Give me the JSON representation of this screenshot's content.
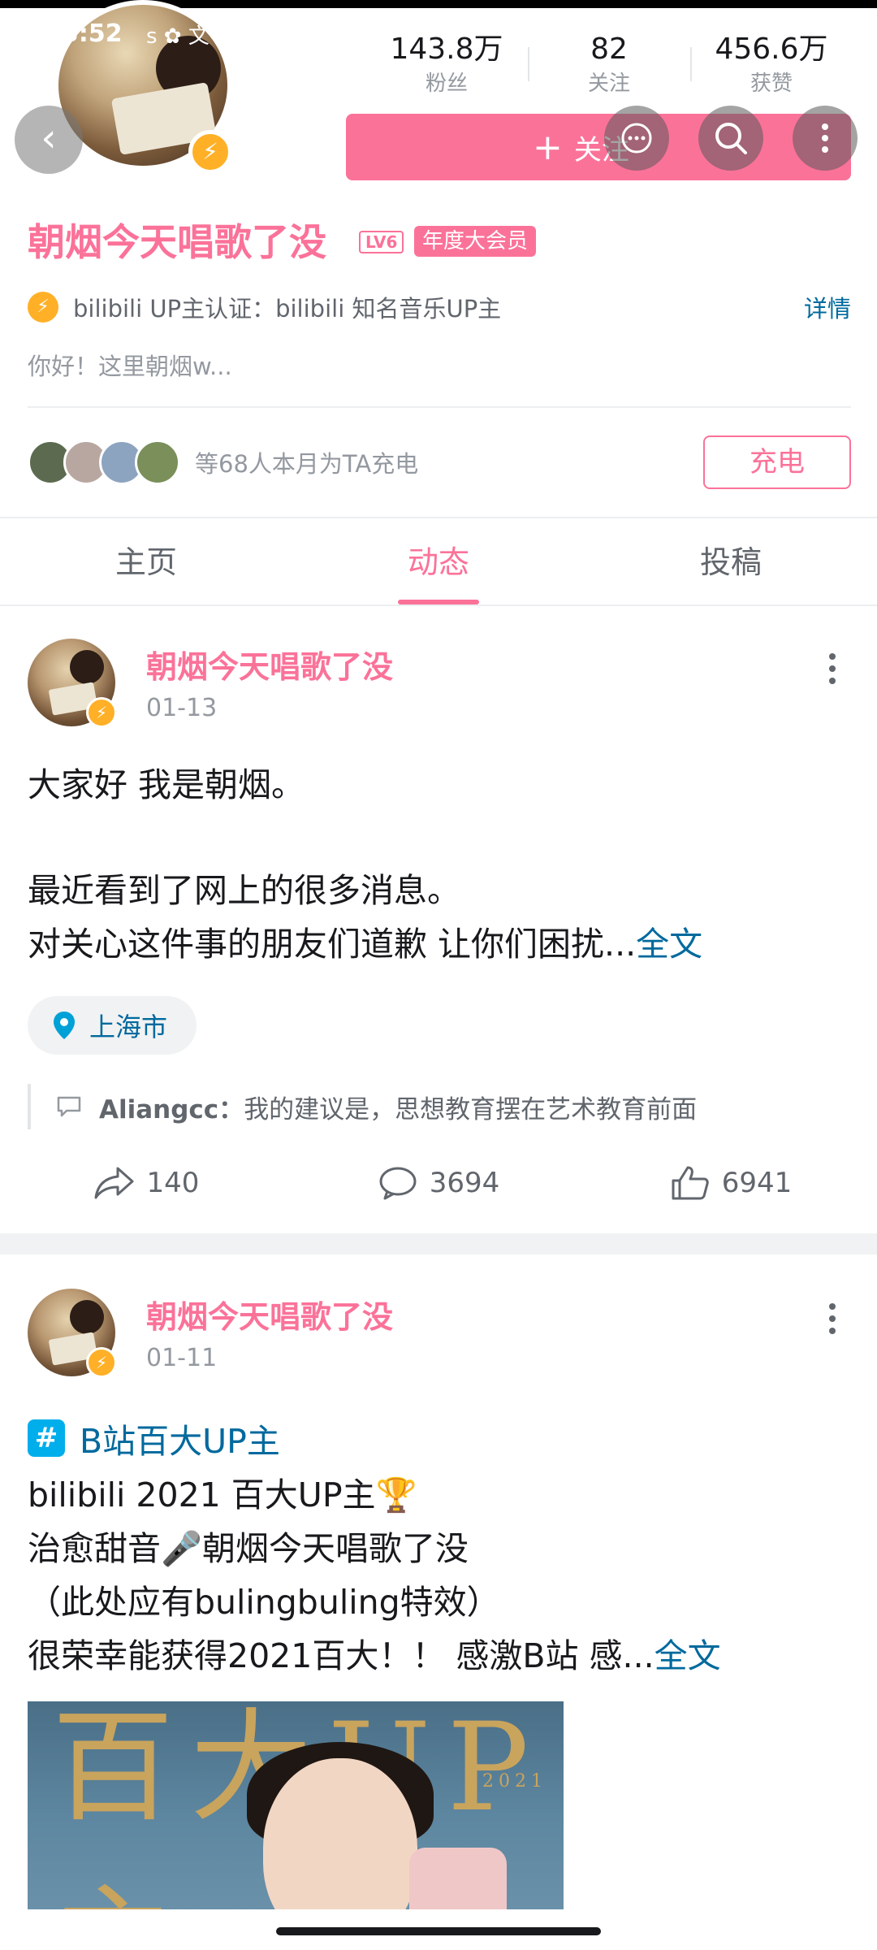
{
  "status_bar": {
    "time": "3:52",
    "icons": "ꜱ ✿ 文"
  },
  "header": {
    "stats": [
      {
        "value": "143.8万",
        "label": "粉丝"
      },
      {
        "value": "82",
        "label": "关注"
      },
      {
        "value": "456.6万",
        "label": "获赞"
      }
    ],
    "follow_label": "关注"
  },
  "profile": {
    "name": "朝烟今天唱歌了没",
    "level": "LV6",
    "vip": "年度大会员",
    "cert_text": "bilibili UP主认证：bilibili 知名音乐UP主",
    "cert_link": "详情",
    "bio": "你好！这里朝烟w...",
    "charge_text": "等68人本月为TA充电",
    "charge_button": "充电",
    "charge_avatar_colors": [
      "#5c6b4f",
      "#b8a7a0",
      "#8da4c0",
      "#7a8f5a"
    ]
  },
  "tabs": [
    {
      "label": "主页",
      "active": false
    },
    {
      "label": "动态",
      "active": true
    },
    {
      "label": "投稿",
      "active": false
    }
  ],
  "posts": [
    {
      "author": "朝烟今天唱歌了没",
      "date": "01-13",
      "lines": [
        "大家好 我是朝烟。",
        "",
        "最近看到了网上的很多消息。",
        "对关心这件事的朋友们道歉 让你们困扰..."
      ],
      "full_link": "全文",
      "location": "上海市",
      "comment_user": "Aliangcc：",
      "comment_text": "我的建议是，思想教育摆在艺术教育前面",
      "shares": "140",
      "comments": "3694",
      "likes": "6941"
    },
    {
      "author": "朝烟今天唱歌了没",
      "date": "01-11",
      "topic": "B站百大UP主",
      "lines": [
        "bilibili 2021 百大UP主🏆",
        "治愈甜音🎤朝烟今天唱歌了没",
        "（此处应有bulingbuling特效）",
        "很荣幸能获得2021百大！！ 感激B站 感..."
      ],
      "full_link": "全文",
      "image_title": "百大UP主",
      "image_year": "2021"
    }
  ],
  "colors": {
    "accent": "#fb7299",
    "link": "#00699d",
    "gold": "#ffb027"
  }
}
